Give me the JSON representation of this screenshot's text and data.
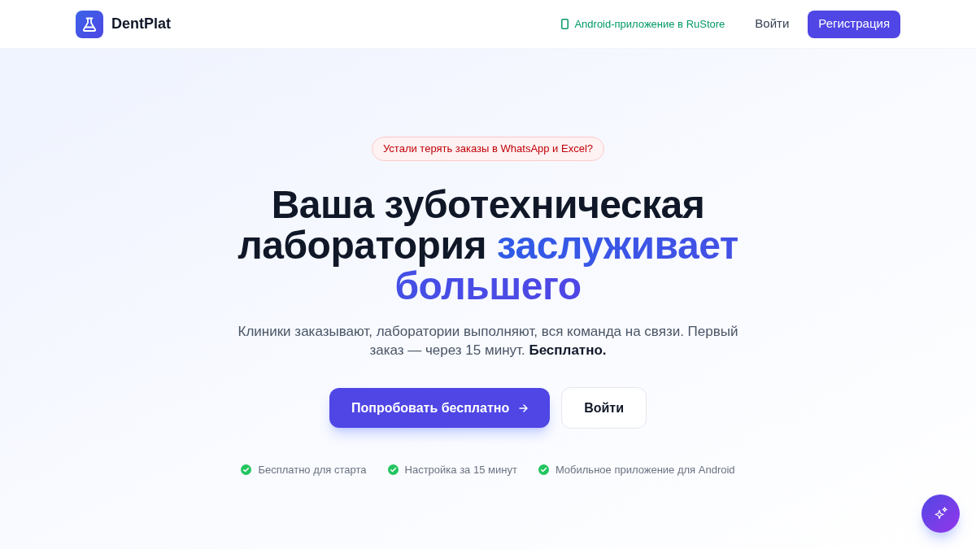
{
  "header": {
    "logo_text": "DentPlat",
    "android_link": "Android-приложение в RuStore",
    "login": "Войти",
    "register": "Регистрация"
  },
  "hero": {
    "badge": "Устали терять заказы в WhatsApp и Excel?",
    "heading": {
      "text": "Ваша зуботехническая лаборатория",
      "highlight": "заслуживает большего"
    },
    "subtitle": "Клиники заказывают, лаборатории выполняют, вся команда на связи. Первый заказ — через 15 минут. **Бесплатно.**",
    "buttons": [
      {
        "label": "Попробовать бесплатно",
        "kind": "primary"
      },
      {
        "label": "Войти",
        "kind": "secondary"
      }
    ],
    "features": [
      "Бесплатно для старта",
      "Настройка за 15 минут",
      "Мобильное приложение для Android"
    ]
  }
}
